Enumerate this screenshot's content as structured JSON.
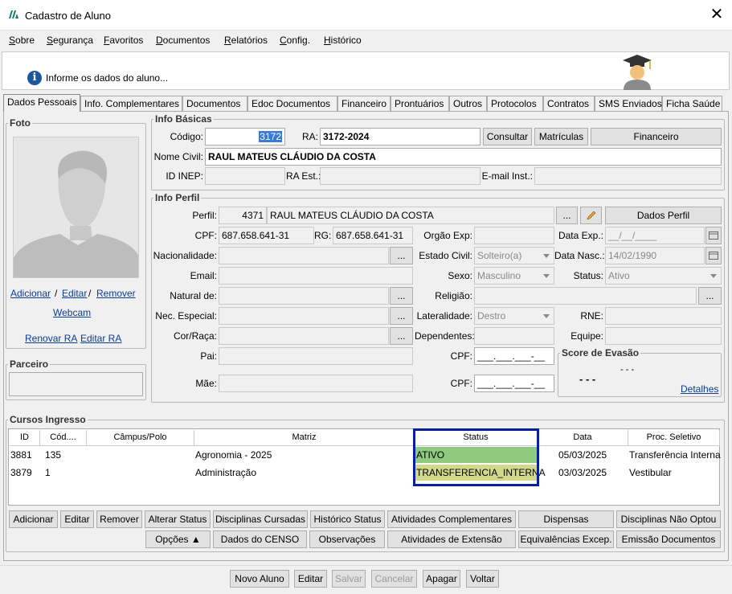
{
  "window": {
    "title": "Cadastro de Aluno"
  },
  "menu": [
    "Sobre",
    "Segurança",
    "Favoritos",
    "Documentos",
    "Relatórios",
    "Config.",
    "Histórico"
  ],
  "info": {
    "text": "Informe os dados do aluno..."
  },
  "tabs": [
    "Dados Pessoais",
    "Info. Complementares",
    "Documentos",
    "Edoc Documentos",
    "Financeiro",
    "Prontuários",
    "Outros",
    "Protocolos",
    "Contratos",
    "SMS Enviados",
    "Ficha Saúde"
  ],
  "foto": {
    "legend": "Foto",
    "adicionar": "Adicionar",
    "sep1": "/",
    "editar": "Editar",
    "sep2": "/",
    "remover": "Remover",
    "webcam": "Webcam",
    "renovar_ra": "Renovar RA",
    "editar_ra": "Editar RA"
  },
  "parceiro": {
    "legend": "Parceiro"
  },
  "basicas": {
    "legend": "Info Básicas",
    "codigo_label": "Código:",
    "codigo": "3172",
    "ra_label": "RA:",
    "ra": "3172-2024",
    "consultar": "Consultar",
    "matriculas": "Matrículas",
    "financeiro": "Financeiro",
    "nome_label": "Nome Civil:",
    "nome": "RAUL MATEUS CLÁUDIO DA COSTA",
    "inep_label": "ID INEP:",
    "ra_est_label": "RA Est.:",
    "email_inst_label": "E-mail Inst.:"
  },
  "perfil": {
    "legend": "Info Perfil",
    "perfil_label": "Perfil:",
    "perfil_id": "4371",
    "perfil_nome": "RAUL MATEUS CLÁUDIO DA COSTA",
    "dots": "...",
    "dados_perfil": "Dados Perfil",
    "cpf_label": "CPF:",
    "cpf": "687.658.641-31",
    "rg_label": "RG:",
    "rg": "687.658.641-31",
    "orgao_label": "Orgão Exp:",
    "data_exp_label": "Data Exp.:",
    "data_exp": "__/__/____",
    "nacionalidade_label": "Nacionalidade:",
    "estado_civil_label": "Estado Civil:",
    "estado_civil": "Solteiro(a)",
    "data_nasc_label": "Data Nasc.:",
    "data_nasc": "14/02/1990",
    "email_label": "Email:",
    "sexo_label": "Sexo:",
    "sexo": "Masculino",
    "status_label": "Status:",
    "status": "Ativo",
    "natural_label": "Natural de:",
    "religiao_label": "Religião:",
    "nec_label": "Nec. Especial:",
    "lateralidade_label": "Lateralidade:",
    "lateralidade": "Destro",
    "rne_label": "RNE:",
    "cor_label": "Cor/Raça:",
    "dependentes_label": "Dependentes:",
    "equipe_label": "Equipe:",
    "pai_label": "Pai:",
    "cpf_pai_label": "CPF:",
    "cpf_pai": "___.___.___-__",
    "mae_label": "Mãe:",
    "cpf_mae_label": "CPF:",
    "cpf_mae": "___.___.___-__",
    "score_legend": "Score de Evasão",
    "score_small": "- - -",
    "score_big": "- - -",
    "detalhes": "Detalhes"
  },
  "cursos": {
    "legend": "Cursos Ingresso",
    "headers": [
      "ID",
      "Cód....",
      "Câmpus/Polo",
      "Matriz",
      "Status",
      "Data",
      "Proc. Seletivo"
    ],
    "rows": [
      {
        "id": "3881",
        "cod": "135",
        "campus": "",
        "matriz": "Agronomia - 2025",
        "status": "ATIVO",
        "data": "05/03/2025",
        "proc": "Transferência Interna"
      },
      {
        "id": "3879",
        "cod": "1",
        "campus": "",
        "matriz": "Administração",
        "status": "TRANSFERENCIA_INTERNA",
        "data": "03/03/2025",
        "proc": "Vestibular"
      }
    ],
    "status_colors": {
      "ATIVO": "#8fca80",
      "TRANSFERENCIA_INTERNA": "#d3d98a"
    },
    "highlight_color": "#0a1f9e"
  },
  "actions_row1": [
    "Adicionar",
    "Editar",
    "Remover",
    "Alterar Status",
    "Disciplinas Cursadas",
    "Histórico Status",
    "Atividades Complementares",
    "Dispensas",
    "Disciplinas Não Optou"
  ],
  "actions_row2": [
    "Opções ▲",
    "Dados do CENSO",
    "Observações",
    "Atividades de Extensão",
    "Equivalências Excep.",
    "Emissão Documentos"
  ],
  "bottom": [
    "Novo Aluno",
    "Editar",
    "Salvar",
    "Cancelar",
    "Apagar",
    "Voltar"
  ]
}
